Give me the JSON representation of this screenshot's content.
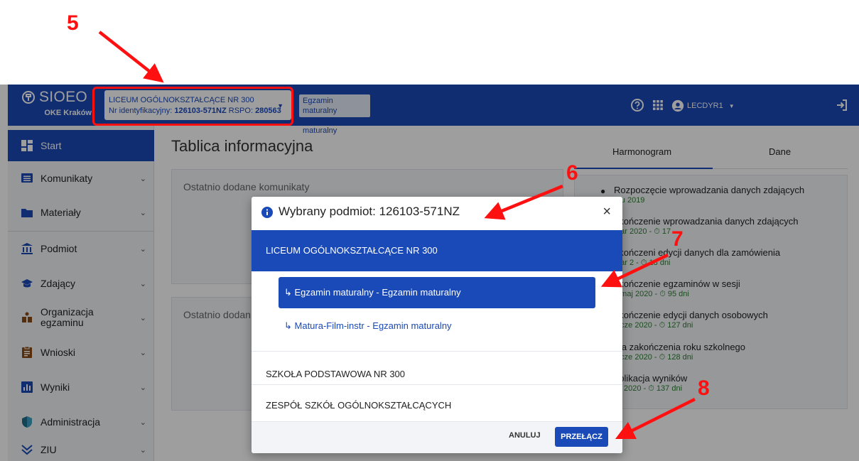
{
  "app": {
    "name": "SIOEO",
    "org": "OKE Kraków"
  },
  "entity_selector": {
    "name": "LICEUM OGÓLNOKSZTAŁCĄCE NR 300",
    "id_label": "Nr identyfikacyjny:",
    "id_value": "126103-571NZ",
    "rspo_label": "RSPO:",
    "rspo_value": "280563"
  },
  "exam_chip": {
    "line1": "Egzamin maturalny",
    "line2": "Egzamin maturalny"
  },
  "header": {
    "user": "LECDYR1",
    "help_icon": "help-icon",
    "apps_icon": "apps-grid-icon",
    "logout_icon": "logout-icon"
  },
  "sidebar": {
    "items": [
      {
        "label": "Start",
        "icon": "dashboard-icon"
      },
      {
        "label": "Komunikaty",
        "icon": "message-icon"
      },
      {
        "label": "Materiały",
        "icon": "folder-icon"
      },
      {
        "label": "Podmiot",
        "icon": "institution-icon"
      },
      {
        "label": "Zdający",
        "icon": "graduation-cap-icon"
      },
      {
        "label_line1": "Organizacja",
        "label_line2": "egzaminu",
        "icon": "organization-icon"
      },
      {
        "label": "Wnioski",
        "icon": "clipboard-icon"
      },
      {
        "label": "Wyniki",
        "icon": "chart-icon"
      },
      {
        "label": "Administracja",
        "icon": "shield-icon"
      },
      {
        "label": "ZIU",
        "icon": "ziu-icon"
      }
    ]
  },
  "main": {
    "title": "Tablica informacyjna",
    "card1_title": "Ostatnio dodane komunikaty",
    "card2_title": "Ostatnio dodan"
  },
  "tabs": [
    "Harmonogram",
    "Dane"
  ],
  "schedule": [
    {
      "title": "Rozpoczęcie wprowadzania danych zdających",
      "meta": "gru 2019"
    },
    {
      "title": "akończenie wprowadzania danych zdających",
      "meta": "mar 2020 - ⏱ 17"
    },
    {
      "title": "akończeni  edycji danych dla zamówienia",
      "meta": "mar 2  - ⏱ 18 dni"
    },
    {
      "title": "akończenie egzaminów w sesji",
      "meta": "2 maj 2020 - ⏱ 95 dni"
    },
    {
      "title": "akończenie edycji danych osobowych",
      "meta": "3 cze 2020 - ⏱ 127 dni"
    },
    {
      "title": "ata zakończenia roku szkolnego",
      "meta": "4 cze 2020 - ⏱ 128 dni"
    },
    {
      "title": "ublikacja wyników",
      "meta": "lip 2020 - ⏱ 137 dni"
    }
  ],
  "dialog": {
    "title": "Wybrany podmiot: 126103-571NZ",
    "close": "×",
    "group_selected": "LICEUM OGÓLNOKSZTAŁCĄCE NR 300",
    "options": [
      "↳ Egzamin maturalny - Egzamin maturalny",
      "↳ Matura-Film-instr - Egzamin maturalny"
    ],
    "group2": "SZKOŁA PODSTAWOWA NR 300",
    "group3": "ZESPÓŁ SZKÓŁ OGÓLNOKSZTAŁCĄCYCH",
    "cancel": "ANULUJ",
    "switch": "PRZEŁĄCZ"
  },
  "annotations": {
    "n5": "5",
    "n6": "6",
    "n7": "7",
    "n8": "8",
    "color": "#ff1010"
  },
  "colors": {
    "primary": "#1a49b8",
    "green": "#2e7d32"
  }
}
